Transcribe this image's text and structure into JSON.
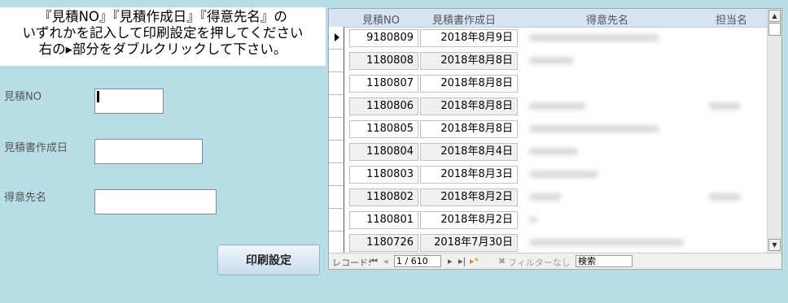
{
  "instruction": {
    "line1": "『見積NO』『見積作成日』『得意先名』の",
    "line2": "いずれかを記入して印刷設定を押してください",
    "line3": "右の▸部分をダブルクリックして下さい。"
  },
  "form": {
    "quote_no_label": "見積NO",
    "quote_date_label": "見積書作成日",
    "customer_label": "得意先名",
    "quote_no_value": "",
    "quote_date_value": "",
    "customer_value": "",
    "print_button": "印刷設定"
  },
  "grid": {
    "columns": [
      "見積NO",
      "見積書作成日",
      "得意先名",
      "担当名"
    ],
    "rows": [
      {
        "no": "9180809",
        "date": "2018年8月9日"
      },
      {
        "no": "1180808",
        "date": "2018年8月8日"
      },
      {
        "no": "1180807",
        "date": "2018年8月8日"
      },
      {
        "no": "1180806",
        "date": "2018年8月8日"
      },
      {
        "no": "1180805",
        "date": "2018年8月8日"
      },
      {
        "no": "1180804",
        "date": "2018年8月4日"
      },
      {
        "no": "1180803",
        "date": "2018年8月3日"
      },
      {
        "no": "1180802",
        "date": "2018年8月2日"
      },
      {
        "no": "1180801",
        "date": "2018年8月2日"
      },
      {
        "no": "1180726",
        "date": "2018年7月30日"
      }
    ]
  },
  "navbar": {
    "record_label": "レコード:",
    "first_glyph": "⏮",
    "prev_glyph": "◂",
    "record_position": "1 / 610",
    "next_glyph": "▸",
    "last_glyph": "▸|",
    "new_glyph": "▸*",
    "filter_label": "フィルターなし",
    "search_label": "検索"
  }
}
